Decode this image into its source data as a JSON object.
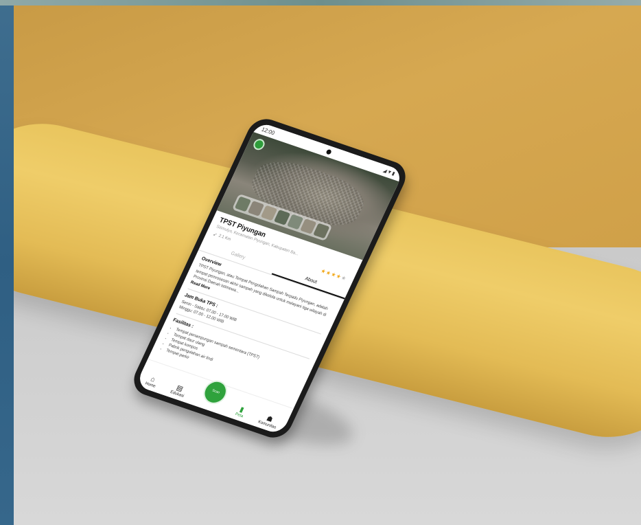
{
  "status_bar": {
    "time": "12:00",
    "icons": "◢▼▮"
  },
  "place": {
    "title": "TPST Piyungan",
    "subtitle": "Sitimulyo, Kecamatan Piyungan, Kabupaten Ba...",
    "distance": "2.1 Km",
    "rating": 4,
    "rating_max": 5
  },
  "tabs": [
    {
      "label": "Gallery",
      "active": false
    },
    {
      "label": "About",
      "active": true
    }
  ],
  "overview": {
    "heading": "Overview",
    "text": "TPST Piyungan, atau Tempat Pengolahan Sampah Terpadu Piyungan, adalah tempat pemrosesan akhir sampah yang dikelola untuk melayani tiga wilayah di Provinsi Daerah Istimewa...",
    "read_more": "Read More"
  },
  "hours": {
    "heading": "Jam Buka TPS :",
    "weekday": "Senin - Sabtu: 07.00 - 17.00 WIB",
    "weekend": "Minggu: 07.00 - 12.00 WIB"
  },
  "facilities": {
    "heading": "Fasilitas :",
    "items": [
      "Tempat penampungan sampah sementara (TPST)",
      "Tempat daur ulang",
      "Tempat kompos",
      "Pabrik pengolahan air lindi",
      "Tempat parkir"
    ]
  },
  "nav": {
    "home": "Home",
    "edukasi": "Edukasi",
    "center": "Scan",
    "peta": "Peta",
    "komunitas": "Komunitas"
  },
  "colors": {
    "accent": "#2fa23c",
    "star": "#f2a91c"
  }
}
